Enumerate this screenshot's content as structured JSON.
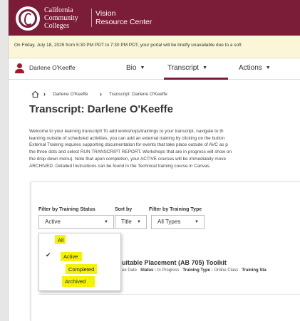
{
  "header": {
    "college_line1": "California",
    "college_line2": "Community",
    "college_line3": "Colleges",
    "vision_line1": "Vision",
    "vision_line2": "Resource Center",
    "brand_color": "#7b1c38"
  },
  "banner": {
    "text": "On Friday, July 18, 2025 from 5:30 PM PDT to 7:30 PM PDT, your portal will be briefly unavailable due to a soft"
  },
  "nav": {
    "user_name": "Darlene O'Keeffe",
    "tabs": [
      {
        "label": "Bio",
        "active": false
      },
      {
        "label": "Transcript",
        "active": true
      },
      {
        "label": "Actions",
        "active": false
      }
    ],
    "home_icon": "home-icon",
    "user_icon": "user-icon"
  },
  "breadcrumb": {
    "items": [
      "Darlene O'Keeffe",
      "Transcript: Darlene O'Keeffe"
    ]
  },
  "page": {
    "title": "Transcript: Darlene O'Keeffe",
    "intro_lines": [
      "Welcome to your learning transcript! To add workshops/trainings to your transcript, navigate to th",
      "learning outside of scheduled activities, you can add an external training by clicking on the button",
      "External Training requires supporting documentation for events that take place outside of AVC as p",
      "the three dots and select RUN TRANSCRIPT REPORT. Workshops that are in progress will show on",
      "the drop down menu). Note that upon completion, your ACTIVE courses will be immediately move",
      "ARCHIVED. Detailed Instructions can be found in the Technical training course in Canvas."
    ]
  },
  "filters": {
    "status_label": "Filter by Training Status",
    "sort_label": "Sort by",
    "type_label": "Filter by Training Type",
    "status_value": "Active",
    "sort_value": "Title",
    "type_value": "All Types",
    "status_options": [
      "All",
      "Active",
      "Completed",
      "Archived"
    ],
    "selected_option": "Active",
    "highlight_color": "#f5f203"
  },
  "course": {
    "title": "uitable Placement (AB 705) Toolkit",
    "meta_prefix": "ue Date",
    "status_label": "Status :",
    "status_value": "In Progress",
    "type_label": "Training Type :",
    "type_value": "Online Class",
    "training_sta": "Training Sta"
  }
}
